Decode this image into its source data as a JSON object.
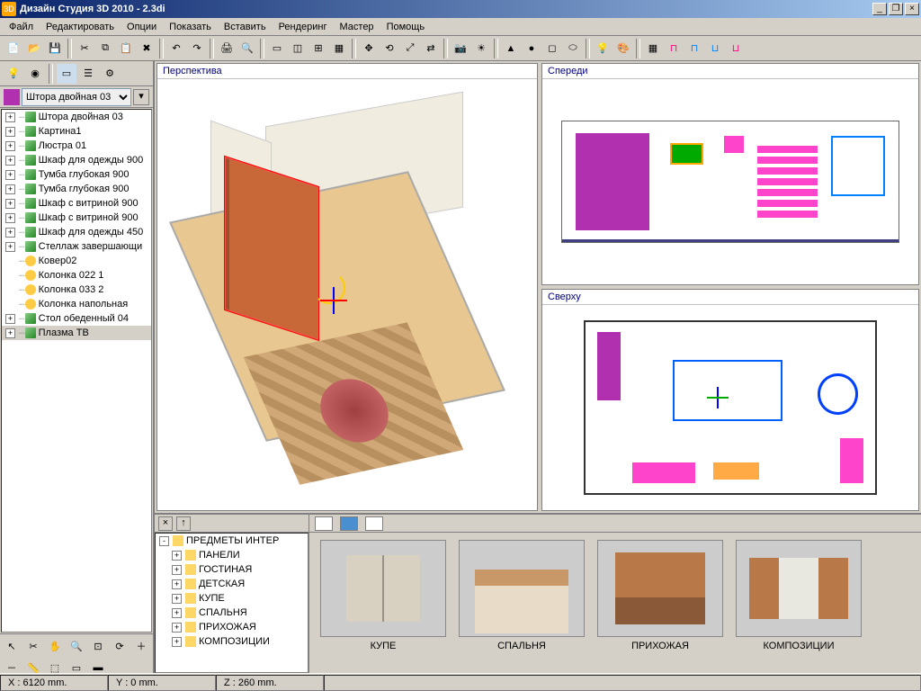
{
  "window": {
    "title": "Дизайн Студия 3D 2010 - 2.3di",
    "min": "_",
    "max": "□",
    "restore": "❐",
    "close": "×"
  },
  "menu": [
    "Файл",
    "Редактировать",
    "Опции",
    "Показать",
    "Вставить",
    "Рендеринг",
    "Мастер",
    "Помощь"
  ],
  "object_dropdown": {
    "value": "Штора двойная 03"
  },
  "scene_tree": [
    {
      "exp": "+",
      "ico": "obj",
      "label": "Штора двойная 03"
    },
    {
      "exp": "+",
      "ico": "obj",
      "label": "Картина1"
    },
    {
      "exp": "+",
      "ico": "obj",
      "label": "Люстра 01"
    },
    {
      "exp": "+",
      "ico": "obj",
      "label": "Шкаф для одежды 900"
    },
    {
      "exp": "+",
      "ico": "obj",
      "label": "Тумба глубокая 900"
    },
    {
      "exp": "+",
      "ico": "obj",
      "label": "Тумба глубокая 900"
    },
    {
      "exp": "+",
      "ico": "obj",
      "label": "Шкаф с витриной 900"
    },
    {
      "exp": "+",
      "ico": "obj",
      "label": "Шкаф с витриной 900"
    },
    {
      "exp": "+",
      "ico": "obj",
      "label": "Шкаф для одежды 450"
    },
    {
      "exp": "+",
      "ico": "obj",
      "label": "Стеллаж завершающи"
    },
    {
      "exp": "",
      "ico": "deco",
      "label": "Ковер02"
    },
    {
      "exp": "",
      "ico": "deco",
      "label": "Колонка 022 1"
    },
    {
      "exp": "",
      "ico": "deco",
      "label": "Колонка 033 2"
    },
    {
      "exp": "",
      "ico": "deco",
      "label": "Колонка напольная"
    },
    {
      "exp": "+",
      "ico": "obj",
      "label": "Стол обеденный 04"
    },
    {
      "exp": "+",
      "ico": "obj",
      "label": "Плазма ТВ",
      "sel": true
    }
  ],
  "viewports": {
    "perspective": "Перспектива",
    "front": "Спереди",
    "top": "Сверху"
  },
  "library_tree": [
    {
      "exp": "-",
      "label": "ПРЕДМЕТЫ ИНТЕР"
    },
    {
      "exp": "+",
      "label": "ПАНЕЛИ",
      "indent": true
    },
    {
      "exp": "+",
      "label": "ГОСТИНАЯ",
      "indent": true
    },
    {
      "exp": "+",
      "label": "ДЕТСКАЯ",
      "indent": true
    },
    {
      "exp": "+",
      "label": "КУПЕ",
      "indent": true
    },
    {
      "exp": "+",
      "label": "СПАЛЬНЯ",
      "indent": true
    },
    {
      "exp": "+",
      "label": "ПРИХОЖАЯ",
      "indent": true
    },
    {
      "exp": "+",
      "label": "КОМПОЗИЦИИ",
      "indent": true
    }
  ],
  "thumbs": [
    {
      "label": "КУПЕ",
      "cls": "th1"
    },
    {
      "label": "СПАЛЬНЯ",
      "cls": "th2"
    },
    {
      "label": "ПРИХОЖАЯ",
      "cls": "th3"
    },
    {
      "label": "КОМПОЗИЦИИ",
      "cls": "th4"
    }
  ],
  "status": {
    "x": "X : 6120 mm.",
    "y": "Y : 0 mm.",
    "z": "Z : 260 mm."
  }
}
